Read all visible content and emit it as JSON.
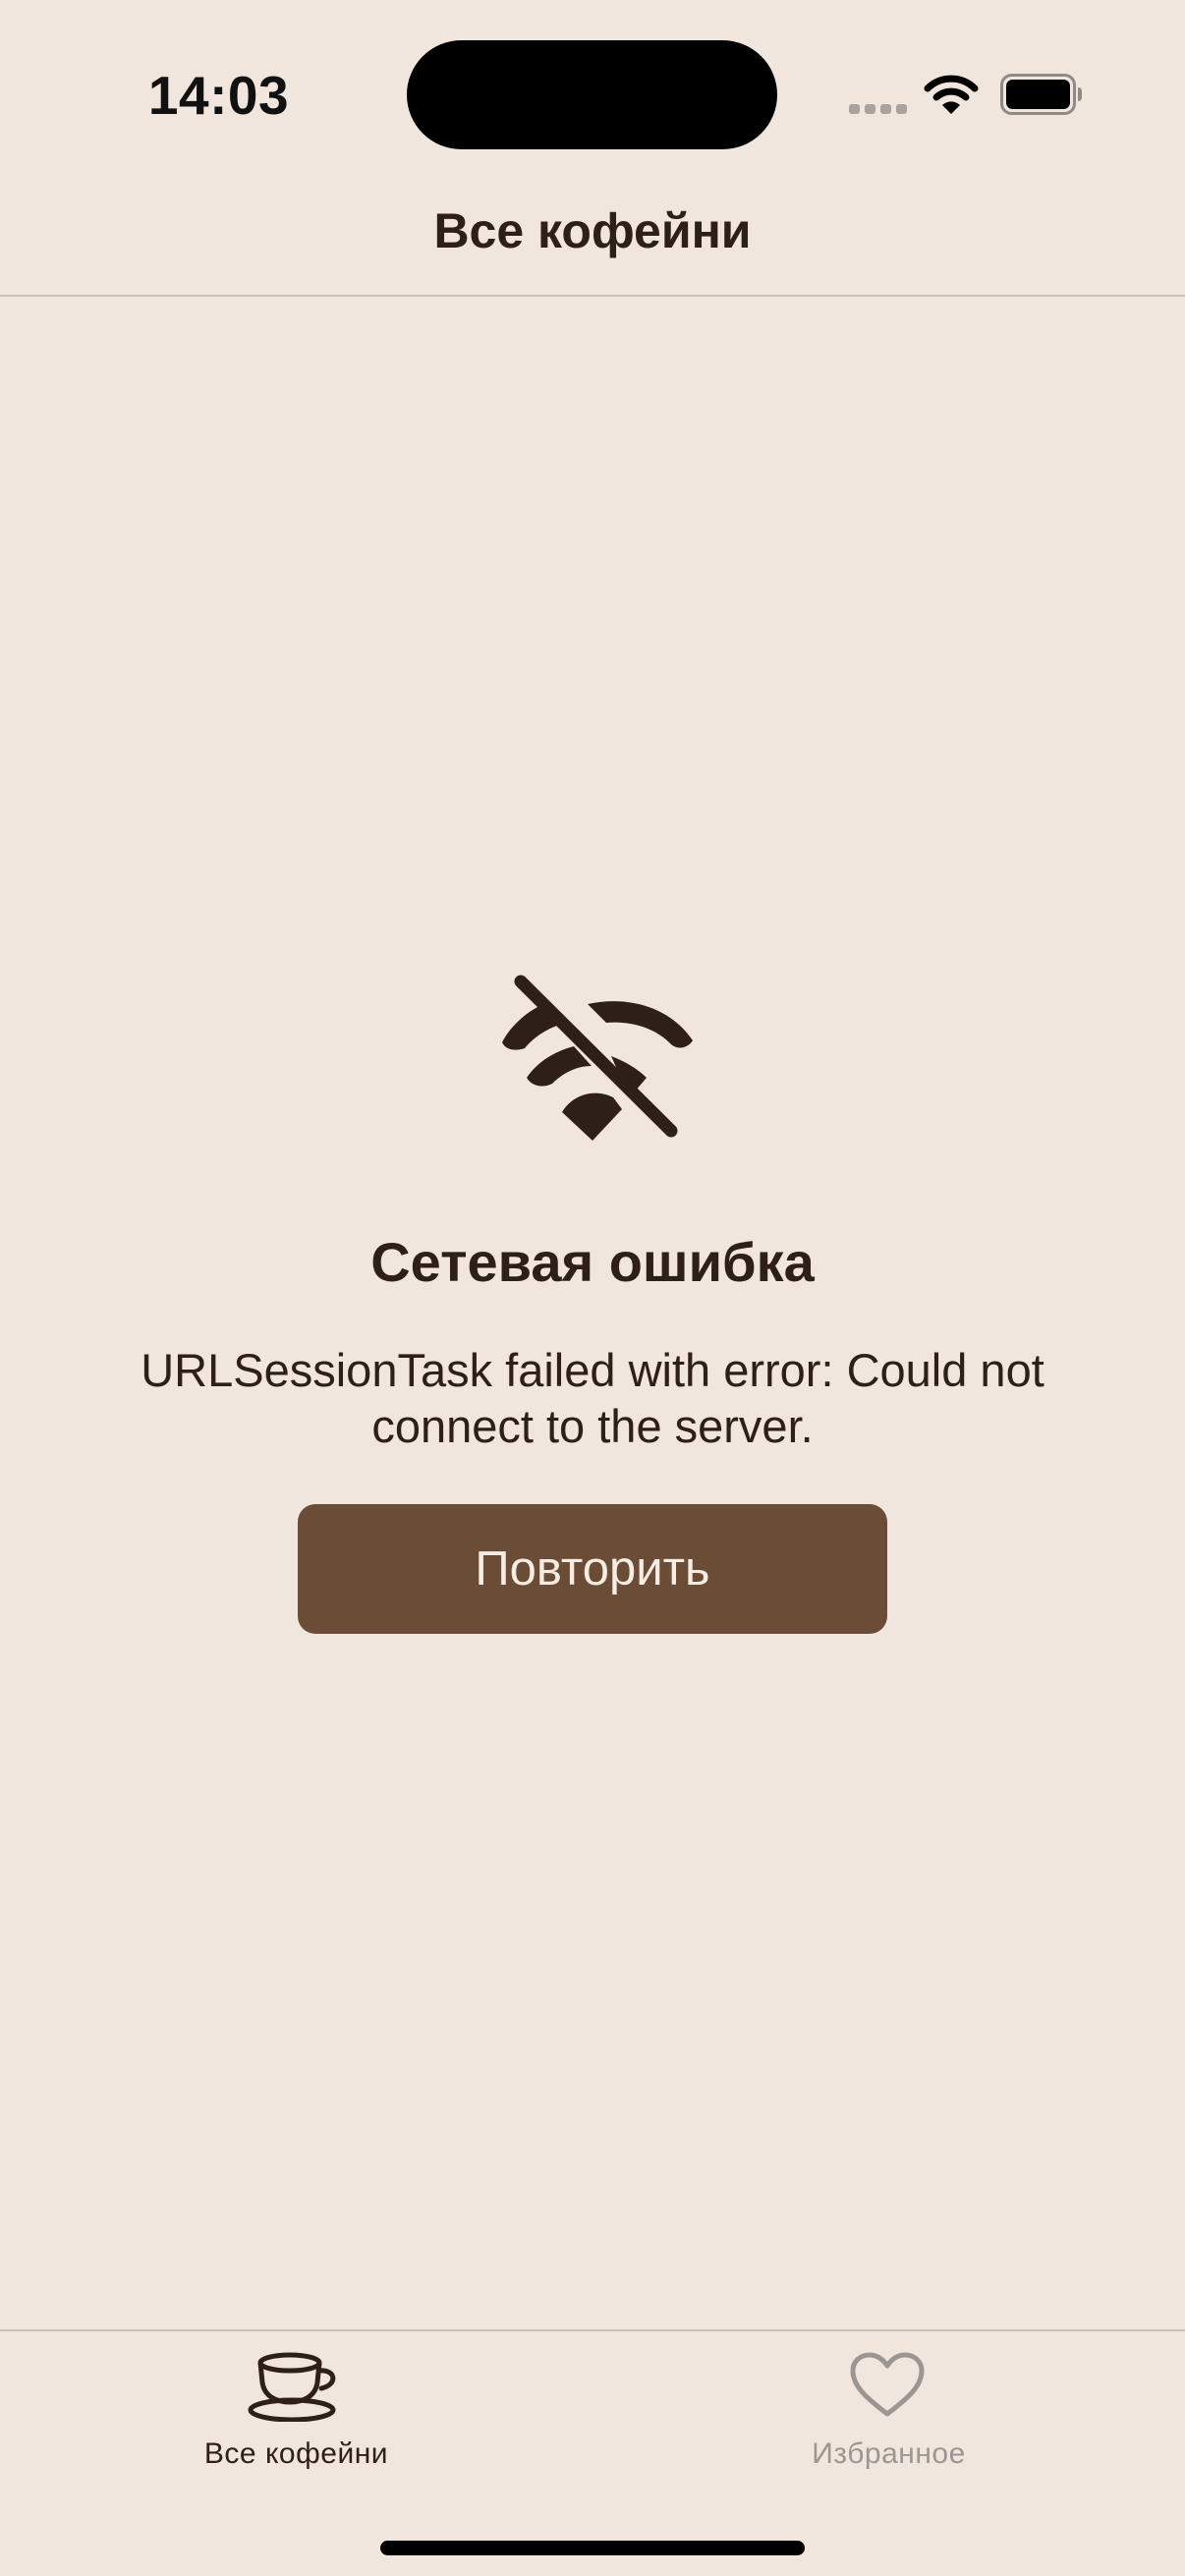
{
  "status_bar": {
    "time": "14:03",
    "icons": [
      "cellular-dots-icon",
      "wifi-icon",
      "battery-icon"
    ]
  },
  "nav": {
    "title": "Все кофейни"
  },
  "error": {
    "icon": "wifi-slash-icon",
    "title": "Сетевая ошибка",
    "message": "URLSessionTask failed with error: Could not connect to the server.",
    "retry_label": "Повторить"
  },
  "tab_bar": {
    "tabs": [
      {
        "label": "Все кофейни",
        "icon": "coffee-cup-icon",
        "selected": true
      },
      {
        "label": "Избранное",
        "icon": "heart-icon",
        "selected": false
      }
    ]
  },
  "colors": {
    "background": "#f0e6dd",
    "text": "#2e2019",
    "accent_button": "#6b4c37",
    "button_text": "#f6ece3",
    "tab_inactive": "#9b9692"
  }
}
